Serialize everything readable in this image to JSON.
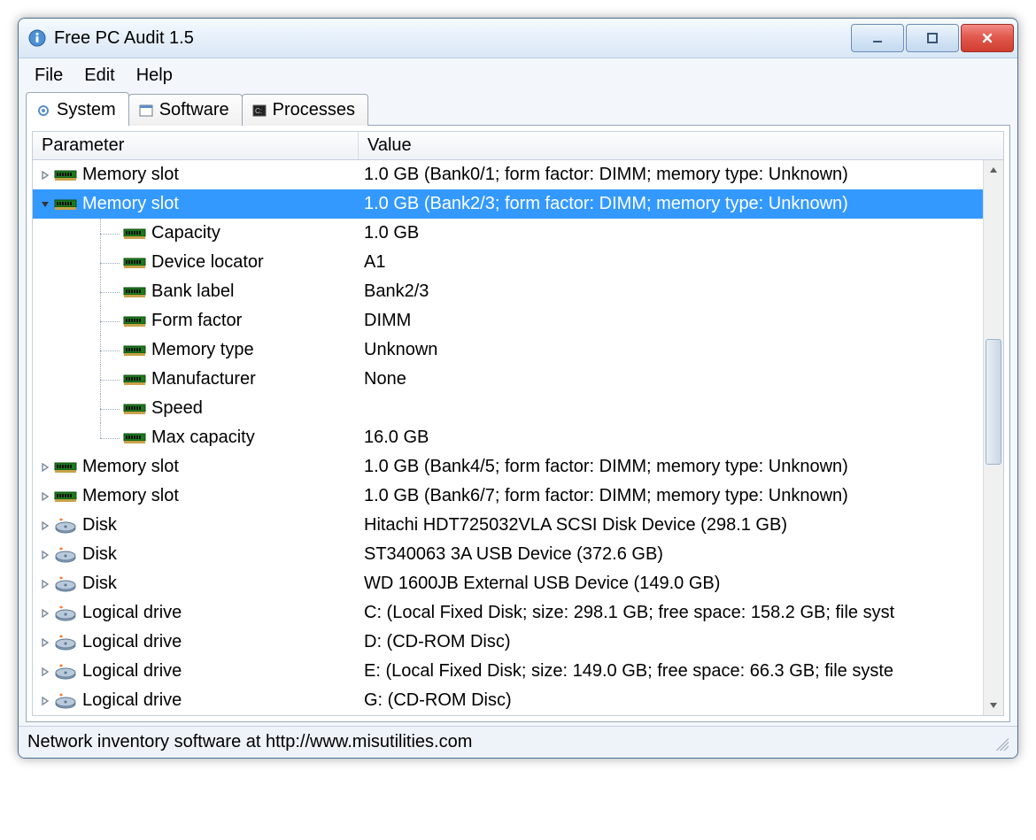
{
  "window": {
    "title": "Free PC Audit 1.5"
  },
  "menu": {
    "file": "File",
    "edit": "Edit",
    "help": "Help"
  },
  "tabs": {
    "system": "System",
    "software": "Software",
    "processes": "Processes"
  },
  "columns": {
    "parameter": "Parameter",
    "value": "Value"
  },
  "rows": [
    {
      "type": "node",
      "expanded": false,
      "icon": "ram",
      "label": "Memory slot",
      "value": "1.0 GB (Bank0/1; form factor: DIMM; memory type: Unknown)"
    },
    {
      "type": "node",
      "expanded": true,
      "selected": true,
      "icon": "ram",
      "label": "Memory slot",
      "value": "1.0 GB (Bank2/3; form factor: DIMM; memory type: Unknown)"
    },
    {
      "type": "child",
      "icon": "ram",
      "label": "Capacity",
      "value": "1.0 GB"
    },
    {
      "type": "child",
      "icon": "ram",
      "label": "Device locator",
      "value": "A1"
    },
    {
      "type": "child",
      "icon": "ram",
      "label": "Bank label",
      "value": "Bank2/3"
    },
    {
      "type": "child",
      "icon": "ram",
      "label": "Form factor",
      "value": "DIMM"
    },
    {
      "type": "child",
      "icon": "ram",
      "label": "Memory type",
      "value": "Unknown"
    },
    {
      "type": "child",
      "icon": "ram",
      "label": "Manufacturer",
      "value": "None"
    },
    {
      "type": "child",
      "icon": "ram",
      "label": "Speed",
      "value": ""
    },
    {
      "type": "child",
      "last": true,
      "icon": "ram",
      "label": "Max capacity",
      "value": "16.0 GB"
    },
    {
      "type": "node",
      "expanded": false,
      "icon": "ram",
      "label": "Memory slot",
      "value": "1.0 GB (Bank4/5; form factor: DIMM; memory type: Unknown)"
    },
    {
      "type": "node",
      "expanded": false,
      "icon": "ram",
      "label": "Memory slot",
      "value": "1.0 GB (Bank6/7; form factor: DIMM; memory type: Unknown)"
    },
    {
      "type": "node",
      "expanded": false,
      "icon": "disk",
      "label": "Disk",
      "value": "Hitachi HDT725032VLA SCSI Disk Device (298.1 GB)"
    },
    {
      "type": "node",
      "expanded": false,
      "icon": "disk",
      "label": "Disk",
      "value": "ST340063 3A USB Device (372.6 GB)"
    },
    {
      "type": "node",
      "expanded": false,
      "icon": "disk",
      "label": "Disk",
      "value": "WD 1600JB External USB Device (149.0 GB)"
    },
    {
      "type": "node",
      "expanded": false,
      "icon": "drive",
      "label": "Logical drive",
      "value": "C: (Local Fixed Disk; size: 298.1 GB; free space: 158.2 GB; file syst"
    },
    {
      "type": "node",
      "expanded": false,
      "icon": "drive",
      "label": "Logical drive",
      "value": "D: (CD-ROM Disc)"
    },
    {
      "type": "node",
      "expanded": false,
      "icon": "drive",
      "label": "Logical drive",
      "value": "E: (Local Fixed Disk; size: 149.0 GB; free space: 66.3 GB; file syste"
    },
    {
      "type": "node",
      "expanded": false,
      "icon": "drive",
      "label": "Logical drive",
      "value": "G: (CD-ROM Disc)"
    }
  ],
  "status": {
    "text": "Network inventory software at http://www.misutilities.com"
  }
}
